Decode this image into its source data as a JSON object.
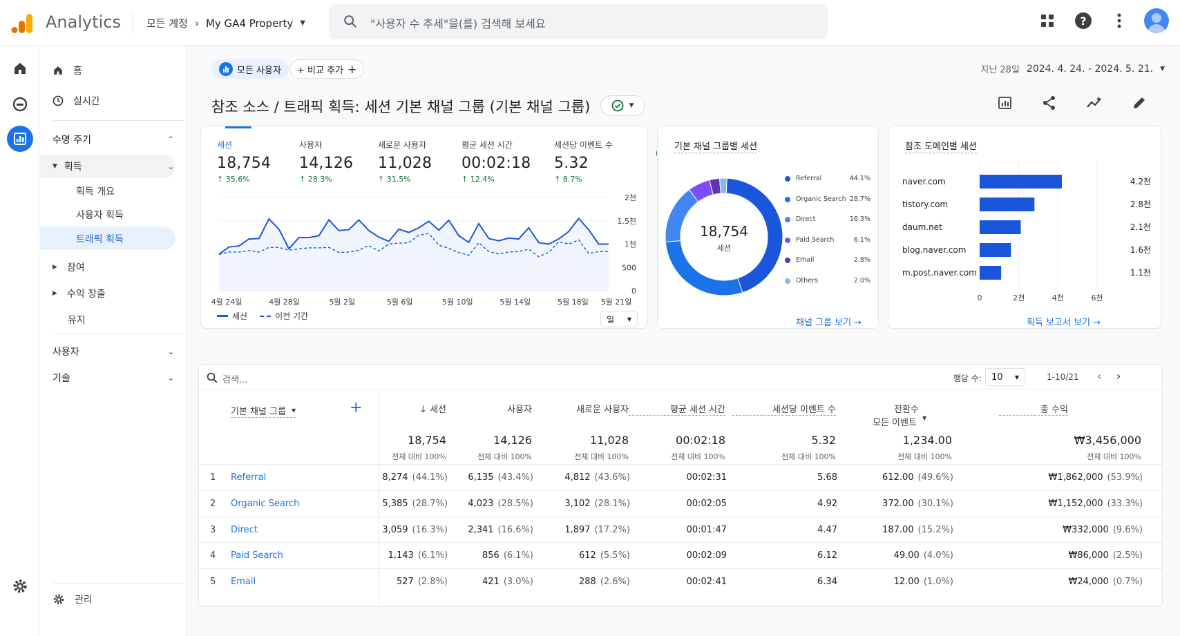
{
  "header": {
    "app_name": "Analytics",
    "account": "모든 계정",
    "property": "My GA4 Property",
    "search_placeholder": "\"사용자 수 추세\"을(를) 검색해 보세요"
  },
  "nav": {
    "home": "홈",
    "realtime": "실시간",
    "lifecycle": "수명 주기",
    "acquisition": "획득",
    "acq_overview": "획득 개요",
    "user_acq": "사용자 획득",
    "traffic_acq": "트래픽 획득",
    "engagement": "참여",
    "monetization": "수익 창출",
    "retention": "유지",
    "user": "사용자",
    "tech": "기술",
    "admin": "관리"
  },
  "filters": {
    "all_users": "모든 사용자",
    "add_compare": "+ 비교 추가",
    "date_label": "지난 28일",
    "date_range": "2024. 4. 24. - 2024. 5. 21."
  },
  "page_title": "참조 소스 / 트래픽 획득: 세션 기본 채널 그룹 (기본 채널 그룹)",
  "metrics": [
    {
      "label": "세션",
      "value": "18,754",
      "delta": "↑ 35.6%"
    },
    {
      "label": "사용자",
      "value": "14,126",
      "delta": "↑ 28.3%"
    },
    {
      "label": "새로운 사용자",
      "value": "11,028",
      "delta": "↑ 31.5%"
    },
    {
      "label": "평균 세션 시간",
      "value": "00:02:18",
      "delta": "↑ 12.4%"
    },
    {
      "label": "세션당 이벤트 수",
      "value": "5.32",
      "delta": "↑ 8.7%"
    }
  ],
  "line_chart": {
    "y_ticks": [
      "2천",
      "1.5천",
      "1천",
      "500",
      "0"
    ],
    "x_ticks": [
      "4월 24일",
      "4월 28일",
      "5월 2일",
      "5월 6일",
      "5월 10일",
      "5월 14일",
      "5월 18일",
      "5월 21일"
    ],
    "legend_current": "세션",
    "legend_prev": "이전 기간",
    "granularity": "일"
  },
  "donut": {
    "title": "기본 채널 그룹별 세션",
    "center_value": "18,754",
    "center_label": "세션",
    "link": "채널 그룹 보기 →"
  },
  "bar": {
    "title": "참조 도메인별 세션",
    "link": "획득 보고서 보기 →",
    "x_ticks": [
      "0",
      "2천",
      "4천",
      "6천"
    ]
  },
  "table": {
    "search_placeholder": "검색...",
    "rows_per_page_label": "행당 수:",
    "rows_per_page": "10",
    "pagination": "1-10/21",
    "dim_header": "기본 채널 그룹",
    "headers": [
      "↓ 세션",
      "사용자",
      "새로운 사용자",
      "평균 세션 시간",
      "세션당 이벤트 수",
      "전환수",
      "총 수익"
    ],
    "conv_sub": "모든 이벤트",
    "totals": [
      "18,754",
      "14,126",
      "11,028",
      "00:02:18",
      "5.32",
      "1,234.00",
      "₩3,456,000"
    ],
    "totals_pct": "전체 대비 100%",
    "rows": [
      {
        "n": "1",
        "name": "Referral",
        "s": "8,274",
        "sp": "(44.1%)",
        "u": "6,135",
        "up": "(43.4%)",
        "nu": "4,812",
        "nup": "(43.6%)",
        "t": "00:02:31",
        "e": "5.68",
        "c": "612.00",
        "cp": "(49.6%)",
        "r": "₩1,862,000",
        "rp": "(53.9%)"
      },
      {
        "n": "2",
        "name": "Organic Search",
        "s": "5,385",
        "sp": "(28.7%)",
        "u": "4,023",
        "up": "(28.5%)",
        "nu": "3,102",
        "nup": "(28.1%)",
        "t": "00:02:05",
        "e": "4.92",
        "c": "372.00",
        "cp": "(30.1%)",
        "r": "₩1,152,000",
        "rp": "(33.3%)"
      },
      {
        "n": "3",
        "name": "Direct",
        "s": "3,059",
        "sp": "(16.3%)",
        "u": "2,341",
        "up": "(16.6%)",
        "nu": "1,897",
        "nup": "(17.2%)",
        "t": "00:01:47",
        "e": "4.47",
        "c": "187.00",
        "cp": "(15.2%)",
        "r": "₩332,000",
        "rp": "(9.6%)"
      },
      {
        "n": "4",
        "name": "Paid Search",
        "s": "1,143",
        "sp": "(6.1%)",
        "u": "856",
        "up": "(6.1%)",
        "nu": "612",
        "nup": "(5.5%)",
        "t": "00:02:09",
        "e": "6.12",
        "c": "49.00",
        "cp": "(4.0%)",
        "r": "₩86,000",
        "rp": "(2.5%)"
      },
      {
        "n": "5",
        "name": "Email",
        "s": "527",
        "sp": "(2.8%)",
        "u": "421",
        "up": "(3.0%)",
        "nu": "288",
        "nup": "(2.6%)",
        "t": "00:02:41",
        "e": "6.34",
        "c": "12.00",
        "cp": "(1.0%)",
        "r": "₩24,000",
        "rp": "(0.7%)"
      }
    ]
  },
  "chart_data": [
    {
      "type": "line",
      "title": "",
      "series": [
        {
          "name": "세션",
          "values": [
            780,
            940,
            960,
            1110,
            1120,
            1540,
            1320,
            900,
            1140,
            1140,
            1180,
            1520,
            1290,
            1310,
            1520,
            1290,
            1150,
            1060,
            1320,
            1250,
            1350,
            1490,
            1300,
            1510,
            1180,
            1040,
            1440,
            1120,
            1070,
            1130,
            1110,
            1350,
            1030,
            1000,
            1110,
            1270,
            1550,
            1310,
            1000,
            1000
          ]
        },
        {
          "name": "이전 기간",
          "values": [
            780,
            830,
            830,
            860,
            830,
            930,
            930,
            870,
            900,
            920,
            920,
            930,
            820,
            830,
            870,
            970,
            850,
            1000,
            1020,
            1030,
            1190,
            1230,
            980,
            910,
            820,
            760,
            1030,
            840,
            790,
            830,
            840,
            890,
            730,
            820,
            1050,
            1000,
            1090,
            800,
            840,
            840
          ]
        }
      ],
      "ylim": [
        0,
        2000
      ]
    },
    {
      "type": "pie",
      "title": "기본 채널 그룹별 세션",
      "categories": [
        "Referral",
        "Organic Search",
        "Direct",
        "Paid Search",
        "Email",
        "Others"
      ],
      "values": [
        44.1,
        28.7,
        16.3,
        6.1,
        2.8,
        2.0
      ],
      "colors": [
        "#1a56db",
        "#1a73e8",
        "#4285f4",
        "#7c4dff",
        "#5e35b1",
        "#8ab4f8"
      ]
    },
    {
      "type": "bar",
      "title": "참조 도메인별 세션",
      "categories": [
        "naver.com",
        "tistory.com",
        "daum.net",
        "blog.naver.com",
        "m.post.naver.com"
      ],
      "values": [
        4200,
        2800,
        2100,
        1600,
        1100
      ],
      "value_labels": [
        "4.2천",
        "2.8천",
        "2.1천",
        "1.6천",
        "1.1천"
      ],
      "xlim": [
        0,
        6000
      ]
    }
  ]
}
